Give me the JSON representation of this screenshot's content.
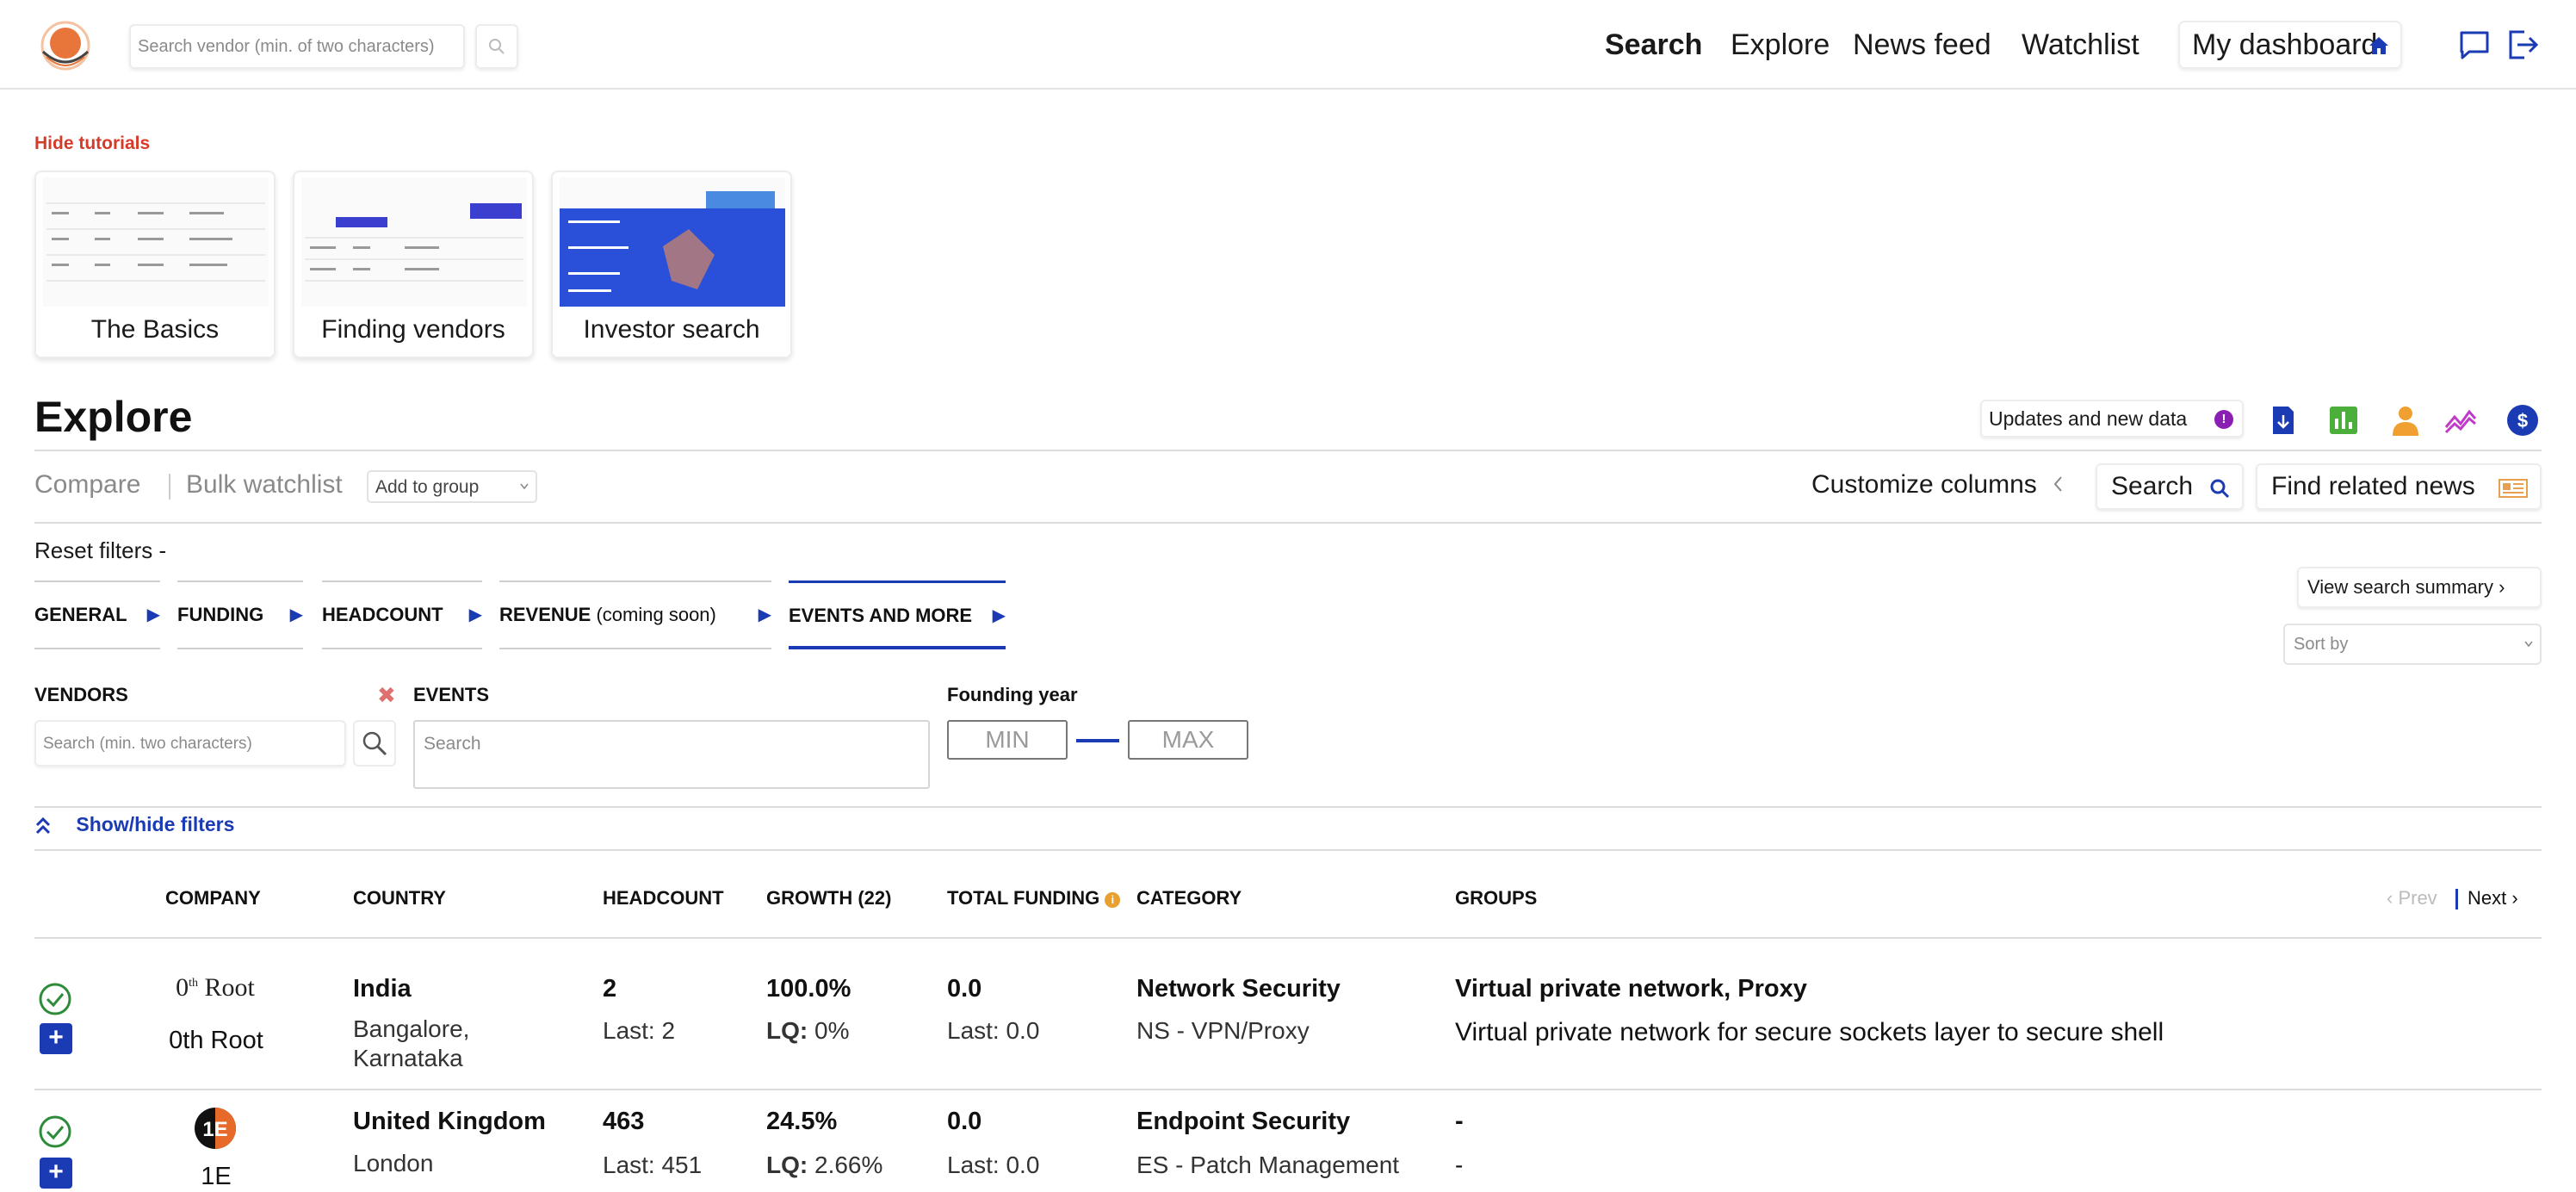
{
  "header": {
    "search_placeholder": "Search vendor (min. of two characters)",
    "nav": {
      "search": "Search",
      "explore": "Explore",
      "news_feed": "News feed",
      "watchlist": "Watchlist",
      "dashboard": "My dashboard"
    },
    "icons": [
      "logo",
      "search-icon",
      "home-icon",
      "chat-icon",
      "logout-icon"
    ]
  },
  "tutorials": {
    "hide_label": "Hide tutorials",
    "cards": [
      {
        "label": "The Basics"
      },
      {
        "label": "Finding vendors"
      },
      {
        "label": "Investor search"
      }
    ]
  },
  "explore": {
    "title": "Explore",
    "updates_label": "Updates and new data",
    "updates_badge": "!",
    "toolbar": {
      "compare": "Compare",
      "bulk_watchlist": "Bulk watchlist",
      "add_to_group": "Add to group",
      "customize_columns": "Customize columns",
      "search": "Search",
      "find_related_news": "Find related news"
    },
    "reset_filters": "Reset filters -",
    "tabs": [
      {
        "label": "GENERAL",
        "extra": ""
      },
      {
        "label": "FUNDING",
        "extra": ""
      },
      {
        "label": "HEADCOUNT",
        "extra": ""
      },
      {
        "label": "REVENUE",
        "extra": " (coming soon)"
      },
      {
        "label": "EVENTS AND MORE",
        "extra": "",
        "active": true
      }
    ],
    "view_search_summary": "View search summary ›",
    "sort_by": "Sort by",
    "filters": {
      "vendors_label": "VENDORS",
      "vendors_placeholder": "Search (min. two characters)",
      "events_label": "EVENTS",
      "events_placeholder": "Search",
      "founding_label": "Founding year",
      "min": "MIN",
      "max": "MAX"
    },
    "show_hide": "Show/hide filters"
  },
  "table": {
    "columns": [
      "COMPANY",
      "COUNTRY",
      "HEADCOUNT",
      "GROWTH (22)",
      "TOTAL FUNDING",
      "CATEGORY",
      "GROUPS"
    ],
    "prev": "‹ Prev",
    "next": "Next ›",
    "rows": [
      {
        "logo_text": "0th Root",
        "company": "0th Root",
        "country": "India",
        "city": "Bangalore,",
        "region": "Karnataka",
        "headcount": "2",
        "headcount_last": "Last: 2",
        "growth": "100.0%",
        "lq_label": "LQ:",
        "lq": "0%",
        "funding": "0.0",
        "funding_last": "Last: 0.0",
        "category": "Network Security",
        "subcategory": "NS - VPN/Proxy",
        "groups": "Virtual private network, Proxy",
        "groups_desc": "Virtual private network for secure sockets layer to secure shell"
      },
      {
        "logo_text": "1E",
        "company": "1E",
        "country": "United Kingdom",
        "city": "London",
        "region": "",
        "headcount": "463",
        "headcount_last": "Last: 451",
        "growth": "24.5%",
        "lq_label": "LQ:",
        "lq": "2.66%",
        "funding": "0.0",
        "funding_last": "Last: 0.0",
        "category": "Endpoint Security",
        "subcategory": "ES - Patch Management",
        "groups": "-",
        "groups_desc": "-"
      }
    ]
  },
  "colors": {
    "accent_blue": "#1a3bb3",
    "tutorial_red": "#d63b2a",
    "check_green": "#2e8b3a",
    "badge_purple": "#8b1fb4"
  }
}
